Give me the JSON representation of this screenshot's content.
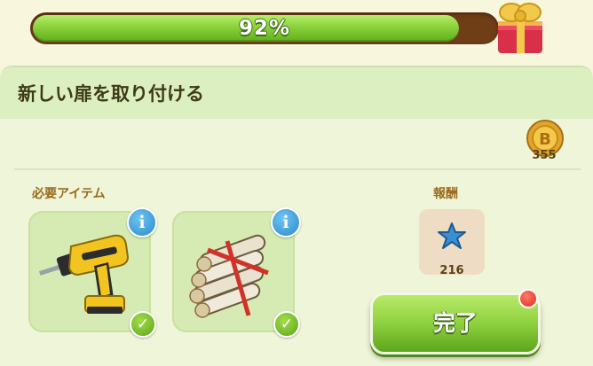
{
  "progress": {
    "percent_text": "92%",
    "fraction": 0.92
  },
  "header_icons": {
    "gift": "gift-box-icon",
    "coin": "coin-icon"
  },
  "task": {
    "title": "新しい扉を取り付ける",
    "coin_reward": "355"
  },
  "required": {
    "label": "必要アイテム",
    "items": [
      {
        "icon": "drill-icon",
        "info": "i",
        "status": "✓"
      },
      {
        "icon": "firewood-icon",
        "info": "i",
        "status": "✓"
      }
    ]
  },
  "reward": {
    "label": "報酬",
    "icon": "star-icon",
    "value": "216"
  },
  "actions": {
    "complete_label": "完了"
  },
  "colors": {
    "accent_green": "#8fd13f",
    "info_blue": "#2b89c9",
    "notify_red": "#e02a1a"
  }
}
